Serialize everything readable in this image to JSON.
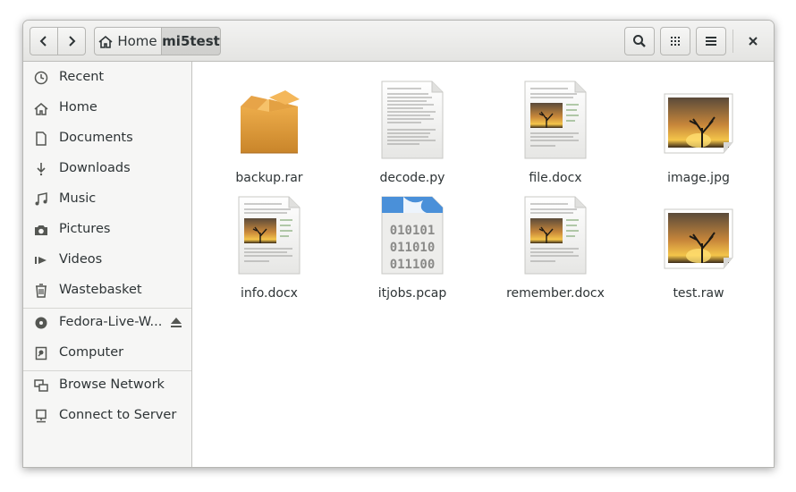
{
  "header": {
    "breadcrumb": [
      {
        "label": "Home"
      },
      {
        "label": "mi5test"
      }
    ]
  },
  "sidebar": {
    "items": [
      {
        "label": "Recent",
        "icon": "clock-icon"
      },
      {
        "label": "Home",
        "icon": "home-icon"
      },
      {
        "label": "Documents",
        "icon": "document-icon"
      },
      {
        "label": "Downloads",
        "icon": "download-icon"
      },
      {
        "label": "Music",
        "icon": "music-icon"
      },
      {
        "label": "Pictures",
        "icon": "camera-icon"
      },
      {
        "label": "Videos",
        "icon": "video-icon"
      },
      {
        "label": "Wastebasket",
        "icon": "trash-icon"
      },
      {
        "label": "Fedora-Live-W...",
        "icon": "disc-icon"
      },
      {
        "label": "Computer",
        "icon": "computer-icon"
      },
      {
        "label": "Browse Network",
        "icon": "network-icon"
      },
      {
        "label": "Connect to Server",
        "icon": "server-icon"
      }
    ]
  },
  "files": [
    {
      "name": "backup.rar",
      "icon": "archive-icon"
    },
    {
      "name": "decode.py",
      "icon": "text-file-icon"
    },
    {
      "name": "file.docx",
      "icon": "document-image-icon"
    },
    {
      "name": "image.jpg",
      "icon": "image-icon"
    },
    {
      "name": "info.docx",
      "icon": "document-image-icon"
    },
    {
      "name": "itjobs.pcap",
      "icon": "binary-file-icon",
      "binary_text": [
        "010101",
        "011010",
        "011100"
      ]
    },
    {
      "name": "remember.docx",
      "icon": "document-image-icon"
    },
    {
      "name": "test.raw",
      "icon": "image-icon"
    }
  ],
  "colors": {
    "accent": "#4a90d9",
    "archive": "#d08d2f",
    "sidebar_bg": "#f6f6f5"
  }
}
